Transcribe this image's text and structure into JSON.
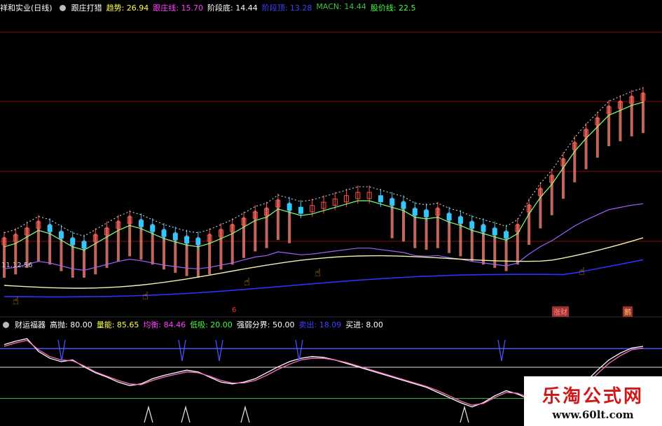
{
  "colors": {
    "up": "#ff5050",
    "down": "#30c8ff",
    "ma_white": "#e0e0e0",
    "ma_green": "#80ff80",
    "band_hist": "#ff8a78",
    "support_yellow": "#f0f0b0",
    "support_blue": "#3030ff",
    "purple": "#a060ff",
    "osc_white": "#ffffff",
    "osc_pink": "#ff70c0",
    "grid_red": "#801010",
    "hline_blue": "#5050ff",
    "hline_white": "#dddddd",
    "hline_green": "#40c040"
  },
  "top_legend": {
    "stock": "祥和实业(日线)",
    "indicator": "跟庄打猎",
    "items": [
      {
        "label": "趋势:",
        "value": "26.94",
        "color": "#ffff50"
      },
      {
        "label": "跟庄线:",
        "value": "15.70",
        "color": "#ff40ff"
      },
      {
        "label": "阶段底:",
        "value": "14.44",
        "color": "#ffffff"
      },
      {
        "label": "阶段顶:",
        "value": "13.28",
        "color": "#4040ff"
      },
      {
        "label": "MACN:",
        "value": "14.44",
        "color": "#40c040"
      },
      {
        "label": "股价线:",
        "value": "22.5",
        "color": "#40ff40"
      }
    ]
  },
  "price_tag": "11.12.56",
  "marks": {
    "six": "6",
    "b1": "涨财",
    "b2": "鹅"
  },
  "bottom_legend": {
    "indicator": "财运福器",
    "items": [
      {
        "label": "高抛:",
        "value": "80.00",
        "color": "#ffffff"
      },
      {
        "label": "量能:",
        "value": "85.65",
        "color": "#ffff50"
      },
      {
        "label": "均衡:",
        "value": "84.46",
        "color": "#ff40ff"
      },
      {
        "label": "低吸:",
        "value": "20.00",
        "color": "#40ff40"
      },
      {
        "label": "强弱分界:",
        "value": "50.00",
        "color": "#ffffff"
      },
      {
        "label": "卖出:",
        "value": "18.09",
        "color": "#4040ff"
      },
      {
        "label": "买进:",
        "value": "8.00",
        "color": "#ffffff"
      }
    ]
  },
  "watermark": {
    "title": "乐淘公式网",
    "url": "www.60lt.com"
  },
  "chart_data": [
    {
      "type": "candlestick",
      "title": "跟庄打猎",
      "series_names": [
        "趋势",
        "跟庄线",
        "阶段底",
        "阶段顶",
        "MACN",
        "股价线"
      ],
      "values_norm": [
        0.12,
        0.14,
        0.18,
        0.22,
        0.2,
        0.16,
        0.12,
        0.1,
        0.14,
        0.18,
        0.22,
        0.25,
        0.23,
        0.2,
        0.17,
        0.15,
        0.13,
        0.12,
        0.14,
        0.17,
        0.2,
        0.24,
        0.28,
        0.3,
        0.35,
        0.33,
        0.31,
        0.32,
        0.34,
        0.36,
        0.38,
        0.4,
        0.4,
        0.38,
        0.36,
        0.34,
        0.3,
        0.29,
        0.3,
        0.27,
        0.25,
        0.22,
        0.2,
        0.18,
        0.16,
        0.2,
        0.32,
        0.42,
        0.5,
        0.6,
        0.7,
        0.78,
        0.85,
        0.92,
        0.95,
        0.98,
        1.0
      ]
    },
    {
      "type": "line",
      "title": "财运福器",
      "series": [
        {
          "name": "量能",
          "values": [
            88,
            92,
            95,
            80,
            72,
            68,
            70,
            62,
            55,
            50,
            44,
            40,
            42,
            48,
            52,
            55,
            58,
            56,
            50,
            44,
            42,
            44,
            48,
            55,
            62,
            68,
            72,
            74,
            73,
            70,
            66,
            62,
            58,
            54,
            50,
            46,
            42,
            38,
            32,
            26,
            20,
            15,
            20,
            28,
            34,
            30,
            24,
            20,
            18,
            22,
            32,
            45,
            58,
            70,
            78,
            84,
            86
          ]
        },
        {
          "name": "均衡",
          "values": [
            86,
            90,
            93,
            82,
            74,
            70,
            69,
            63,
            56,
            51,
            46,
            42,
            41,
            46,
            50,
            53,
            56,
            55,
            51,
            46,
            43,
            43,
            46,
            52,
            59,
            65,
            70,
            72,
            72,
            70,
            67,
            63,
            59,
            55,
            51,
            47,
            43,
            39,
            34,
            28,
            22,
            17,
            19,
            26,
            32,
            31,
            26,
            21,
            19,
            21,
            29,
            41,
            54,
            66,
            75,
            82,
            84
          ]
        }
      ],
      "hlines": {
        "高抛": 80,
        "低吸": 20,
        "强弱分界": 50
      },
      "ylim": [
        0,
        100
      ]
    }
  ]
}
